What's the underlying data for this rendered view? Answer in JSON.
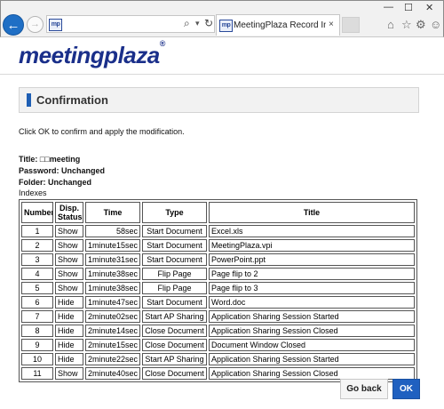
{
  "browser": {
    "back_icon": "←",
    "forward_icon": "→",
    "favicon_text": "mp",
    "search_icon": "⌕",
    "caret_icon": "▾",
    "refresh_icon": "↻",
    "tab_title": "MeetingPlaza Record Infor...",
    "close_icon": "×",
    "minimize_icon": "—",
    "maximize_icon": "☐",
    "window_close_icon": "✕",
    "home_icon": "⌂",
    "favorites_icon": "☆",
    "settings_icon": "⚙",
    "feedback_icon": "☺"
  },
  "logo": {
    "text": "meetingplaza",
    "mark": "®"
  },
  "header": {
    "title": "Confirmation"
  },
  "instruction": "Click OK to confirm and apply the modification.",
  "fields": {
    "title": "Title: □□meeting",
    "password": "Password: Unchanged",
    "folder": "Folder: Unchanged"
  },
  "indexes_label": "Indexes",
  "table": {
    "headers": [
      "Number",
      "Disp. Status",
      "Time",
      "Type",
      "Title"
    ],
    "rows": [
      [
        "1",
        "Show",
        "58sec",
        "Start Document",
        "Excel.xls"
      ],
      [
        "2",
        "Show",
        "1minute15sec",
        "Start Document",
        "MeetingPlaza.vpi"
      ],
      [
        "3",
        "Show",
        "1minute31sec",
        "Start Document",
        "PowerPoint.ppt"
      ],
      [
        "4",
        "Show",
        "1minute38sec",
        "Flip Page",
        "Page flip to 2"
      ],
      [
        "5",
        "Show",
        "1minute38sec",
        "Flip Page",
        "Page flip to 3"
      ],
      [
        "6",
        "Hide",
        "1minute47sec",
        "Start Document",
        "Word.doc"
      ],
      [
        "7",
        "Hide",
        "2minute02sec",
        "Start AP Sharing",
        "Application Sharing Session Started"
      ],
      [
        "8",
        "Hide",
        "2minute14sec",
        "Close Document",
        "Application Sharing Session Closed"
      ],
      [
        "9",
        "Hide",
        "2minute15sec",
        "Close Document",
        "Document Window Closed"
      ],
      [
        "10",
        "Hide",
        "2minute22sec",
        "Start AP Sharing",
        "Application Sharing Session Started"
      ],
      [
        "11",
        "Show",
        "2minute40sec",
        "Close Document",
        "Application Sharing Session Closed"
      ]
    ]
  },
  "buttons": {
    "go_back": "Go back",
    "ok": "OK"
  },
  "colors": {
    "accent": "#1f60c0",
    "logo": "#1a2f8a",
    "back_button": "#1f6fc5"
  }
}
